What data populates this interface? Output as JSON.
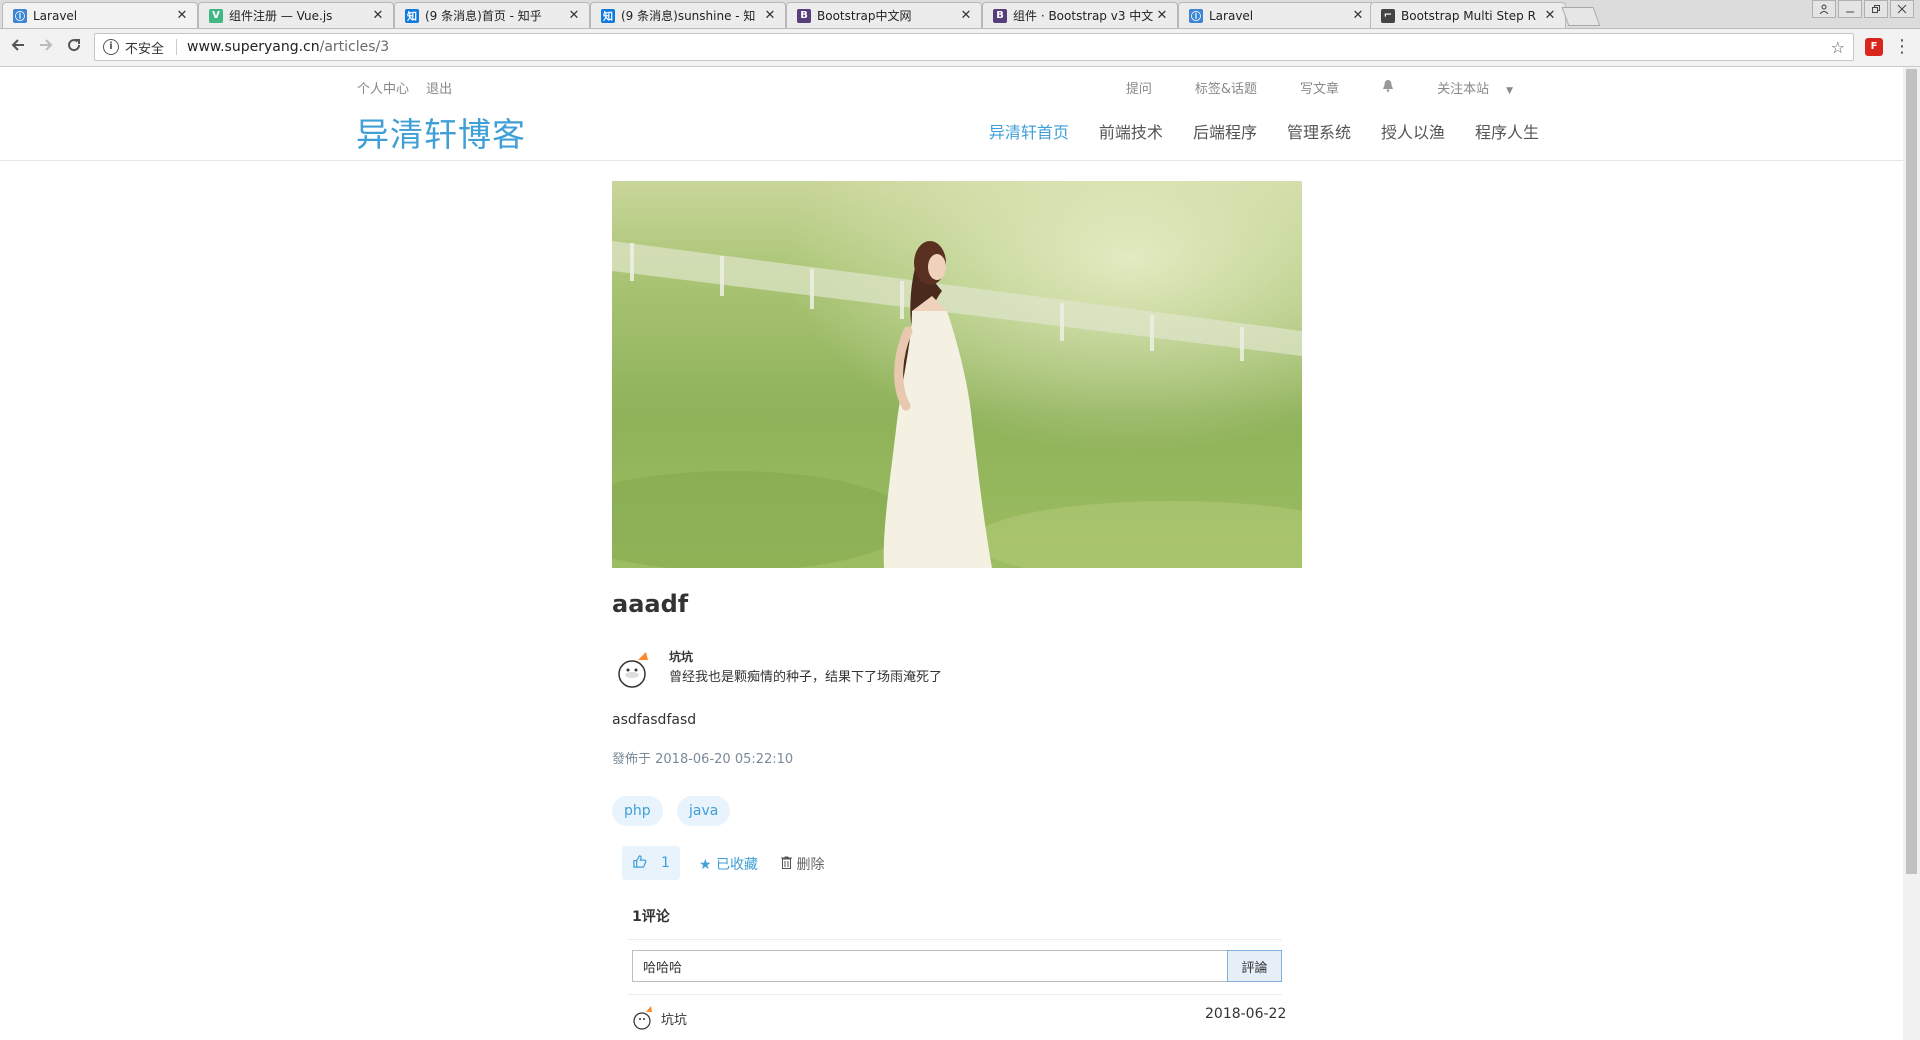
{
  "browser": {
    "tabs": [
      {
        "title": "Laravel",
        "favicon": "laravel-icon",
        "color": "#3b86d6",
        "glyph": "ⓛ"
      },
      {
        "title": "组件注册 — Vue.js",
        "favicon": "vue-icon",
        "color": "#41b883",
        "glyph": "V"
      },
      {
        "title": "(9 条消息)首页 - 知乎",
        "favicon": "zhihu-icon",
        "color": "#0e7ae0",
        "glyph": "知"
      },
      {
        "title": "(9 条消息)sunshine - 知",
        "favicon": "zhihu-icon",
        "color": "#0e7ae0",
        "glyph": "知"
      },
      {
        "title": "Bootstrap中文网",
        "favicon": "bootstrap-icon",
        "color": "#563d7c",
        "glyph": "B"
      },
      {
        "title": "组件 · Bootstrap v3 中文",
        "favicon": "bootstrap-icon",
        "color": "#563d7c",
        "glyph": "B"
      },
      {
        "title": "Laravel",
        "favicon": "laravel-icon",
        "color": "#3b86d6",
        "glyph": "ⓛ"
      },
      {
        "title": "Bootstrap Multi Step R",
        "favicon": "github-icon",
        "color": "#444444",
        "glyph": "⌐"
      }
    ],
    "close_glyph": "✕",
    "insecure_label": "不安全",
    "url_host": "www.superyang.cn",
    "url_path": "/articles/3"
  },
  "header": {
    "top_left": [
      "个人中心",
      "退出"
    ],
    "top_right": {
      "ask": "提问",
      "tags": "标签&话题",
      "write": "写文章",
      "follow": "关注本站"
    },
    "brand": "异清轩博客",
    "nav": [
      "异清轩首页",
      "前端技术",
      "后端程序",
      "管理系统",
      "授人以渔",
      "程序人生"
    ]
  },
  "article": {
    "title": "aaadf",
    "author_name": "坑坑",
    "author_bio": "曾经我也是颗痴情的种子，结果下了场雨淹死了",
    "body": "asdfasdfasd",
    "published": "發佈于 2018-06-20 05:22:10",
    "tags": [
      "php",
      "java"
    ],
    "likes": "1",
    "favorite_label": "已收藏",
    "delete_label": "删除"
  },
  "comments": {
    "count_label": "1评论",
    "input_value": "哈哈哈",
    "submit_label": "評論",
    "items": [
      {
        "author": "坑坑",
        "date": "2018-06-22"
      }
    ]
  },
  "colors": {
    "accent": "#3f9fd6",
    "tag_bg": "#e8f3fc"
  }
}
